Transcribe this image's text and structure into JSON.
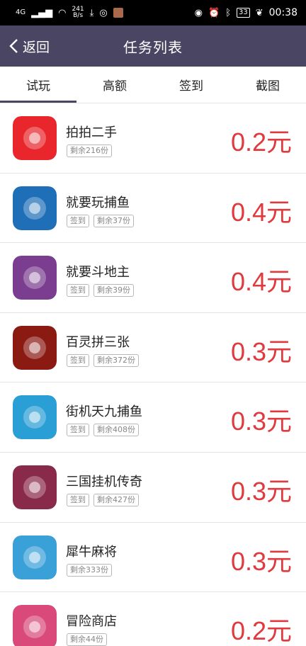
{
  "status_bar": {
    "network": "4G",
    "speed_value": "241",
    "speed_unit": "B/s",
    "battery": "33",
    "time": "00:38"
  },
  "navbar": {
    "back_label": "返回",
    "title": "任务列表"
  },
  "tabs": [
    {
      "label": "试玩",
      "active": true
    },
    {
      "label": "高额",
      "active": false
    },
    {
      "label": "签到",
      "active": false
    },
    {
      "label": "截图",
      "active": false
    }
  ],
  "tasks": [
    {
      "name": "拍拍二手",
      "tags": [
        "剩余216份"
      ],
      "price": "0.2元",
      "icon": "paipai-icon",
      "color": "#e8262b"
    },
    {
      "name": "就要玩捕鱼",
      "tags": [
        "签到",
        "剩余37份"
      ],
      "price": "0.4元",
      "icon": "fishing-game-icon",
      "color": "#1f6fb8"
    },
    {
      "name": "就要斗地主",
      "tags": [
        "签到",
        "剩余39份"
      ],
      "price": "0.4元",
      "icon": "landlord-game-icon",
      "color": "#7a3d8f"
    },
    {
      "name": "百灵拼三张",
      "tags": [
        "签到",
        "剩余372份"
      ],
      "price": "0.3元",
      "icon": "poker-game-icon",
      "color": "#8b1a12"
    },
    {
      "name": "街机天九捕鱼",
      "tags": [
        "签到",
        "剩余408份"
      ],
      "price": "0.3元",
      "icon": "arcade-fishing-icon",
      "color": "#2a9fd6"
    },
    {
      "name": "三国挂机传奇",
      "tags": [
        "签到",
        "剩余427份"
      ],
      "price": "0.3元",
      "icon": "three-kingdoms-icon",
      "color": "#8a2a4a"
    },
    {
      "name": "犀牛麻将",
      "tags": [
        "剩余333份"
      ],
      "price": "0.3元",
      "icon": "rhino-mahjong-icon",
      "color": "#3aa0d8"
    },
    {
      "name": "冒险商店",
      "tags": [
        "剩余44份"
      ],
      "price": "0.2元",
      "icon": "adventure-shop-icon",
      "color": "#d94a7a"
    }
  ]
}
